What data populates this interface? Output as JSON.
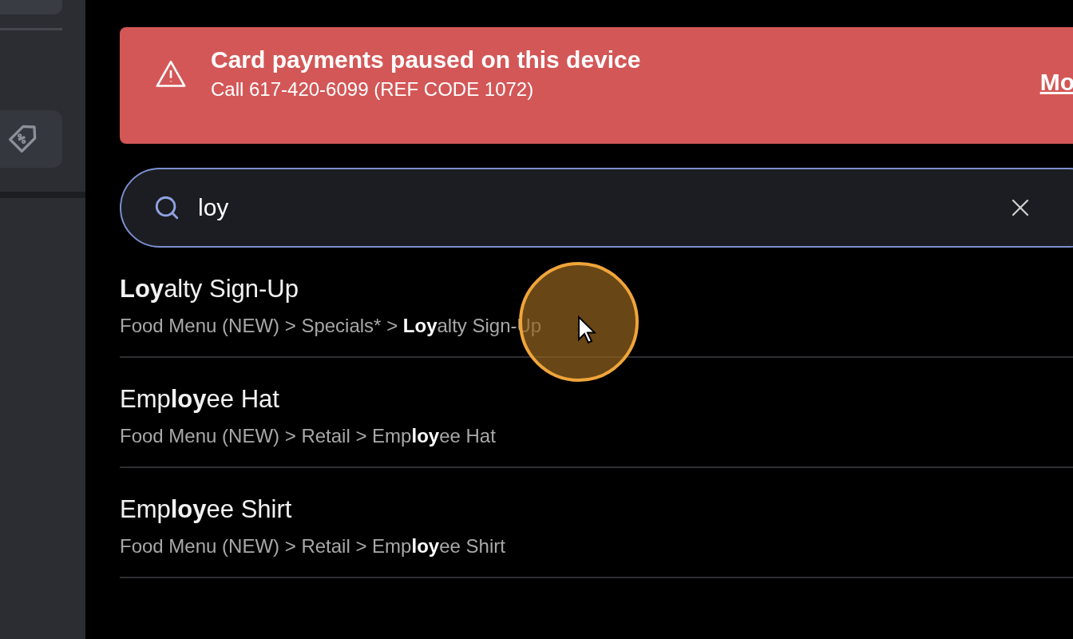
{
  "sidebar": {
    "items": [
      {
        "kind": "discount",
        "selected": false
      }
    ]
  },
  "alert": {
    "title": "Card payments paused on this device",
    "message": "Call 617-420-6099 (REF CODE 1072)",
    "link": "Mo"
  },
  "search": {
    "value": "loy"
  },
  "results": [
    {
      "name": "**Loy**alty Sign-Up",
      "path": "Food Menu (NEW) > Specials* > **Loy**alty Sign-Up"
    },
    {
      "name": "Emp**loy**ee Hat",
      "path": "Food Menu (NEW) > Retail > Emp**loy**ee Hat"
    },
    {
      "name": "Emp**loy**ee Shirt",
      "path": "Food Menu (NEW) > Retail > Emp**loy**ee Shirt"
    }
  ]
}
